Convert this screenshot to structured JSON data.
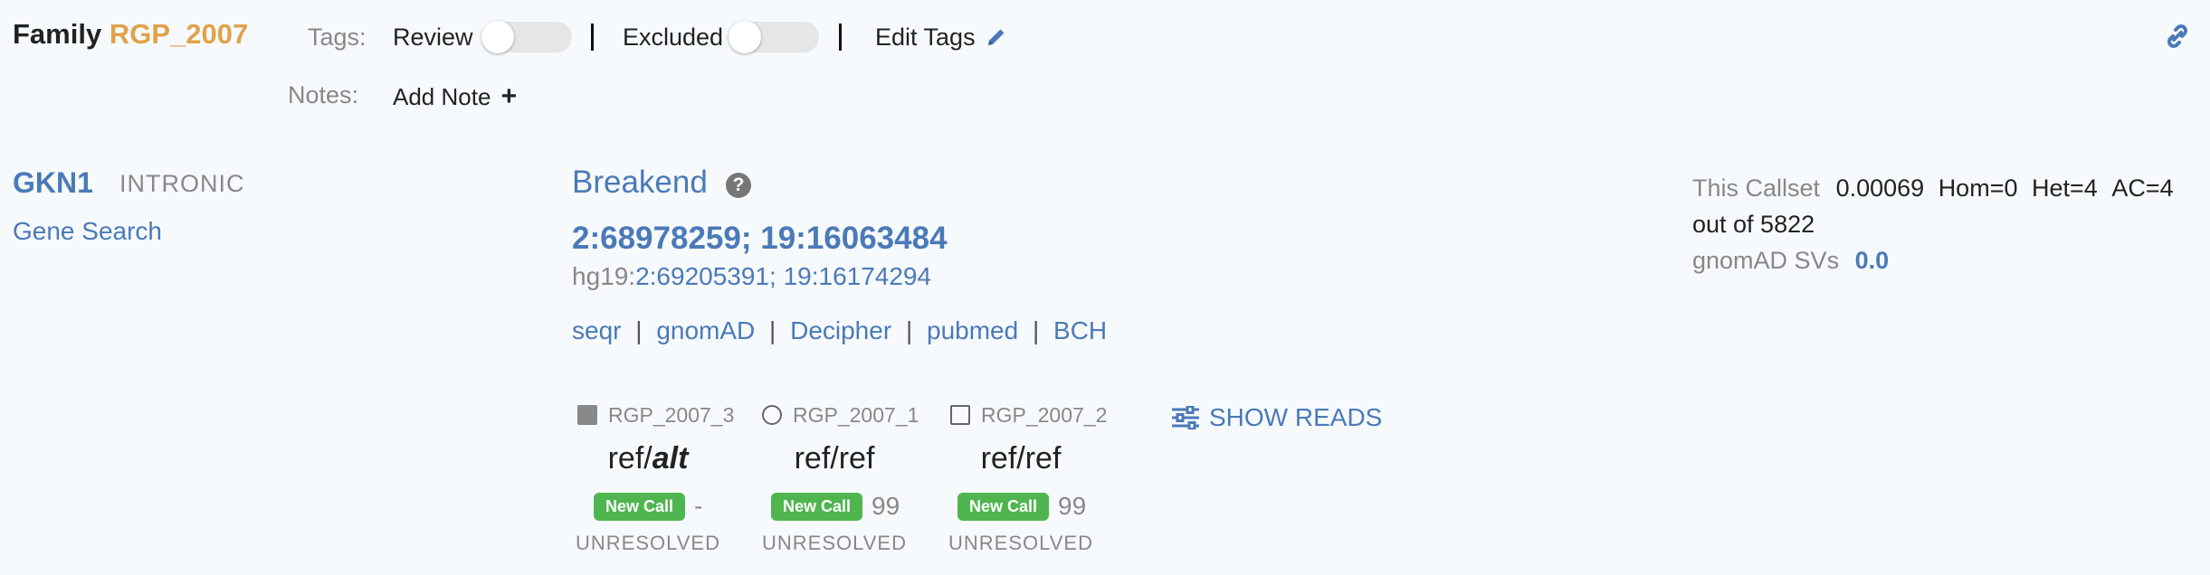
{
  "family": {
    "label": "Family",
    "id": "RGP_2007"
  },
  "tags": {
    "label": "Tags:",
    "review_label": "Review",
    "review_on": false,
    "excluded_label": "Excluded",
    "excluded_on": false,
    "edit_tags_label": "Edit Tags"
  },
  "notes": {
    "label": "Notes:",
    "add_note_label": "Add Note"
  },
  "gene": {
    "symbol": "GKN1",
    "consequence": "INTRONIC",
    "gene_search_label": "Gene Search"
  },
  "variant": {
    "type": "Breakend",
    "pos1": "2:68978259",
    "pos2": "19:16063484",
    "hg19_label": "hg19:",
    "hg19_pos1": "2:69205391",
    "hg19_pos2": "19:16174294",
    "links": [
      "seqr",
      "gnomAD",
      "Decipher",
      "pubmed",
      "BCH"
    ]
  },
  "samples": [
    {
      "id": "RGP_2007_3",
      "icon": "filled-square-icon",
      "genotype_ref": "ref/",
      "genotype_alt": "alt",
      "badge": "New Call",
      "gq": "-",
      "status": "UNRESOLVED"
    },
    {
      "id": "RGP_2007_1",
      "icon": "circle-icon",
      "genotype": "ref/ref",
      "badge": "New Call",
      "gq": "99",
      "status": "UNRESOLVED"
    },
    {
      "id": "RGP_2007_2",
      "icon": "square-icon",
      "genotype": "ref/ref",
      "badge": "New Call",
      "gq": "99",
      "status": "UNRESOLVED"
    }
  ],
  "show_reads_label": "SHOW READS",
  "stats": {
    "callset_label": "This Callset",
    "callset_af": "0.00069",
    "hom": "Hom=0",
    "het": "Het=4",
    "ac": "AC=4",
    "out_of": "out of 5822",
    "gnomad_label": "gnomAD SVs",
    "gnomad_value": "0.0"
  },
  "colors": {
    "link": "#4a7ab8",
    "family_id": "#e0a24a",
    "badge": "#4fb64f"
  }
}
